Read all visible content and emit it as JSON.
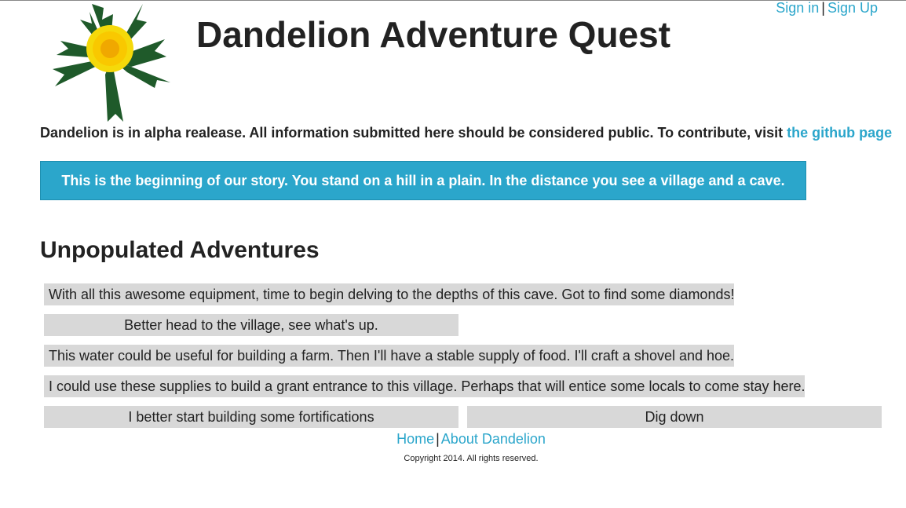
{
  "header": {
    "sign_in": "Sign in",
    "separator": "|",
    "sign_up": "Sign Up",
    "title": "Dandelion Adventure Quest"
  },
  "notice": {
    "text": "Dandelion is in alpha realease. All information submitted here should be considered public. To contribute, visit ",
    "link": "the github page"
  },
  "story": {
    "text": "This is the beginning of our story. You stand on a hill in a plain. In the distance you see a village and a cave."
  },
  "adventures": {
    "heading": "Unpopulated Adventures",
    "items": [
      "With all this awesome equipment, time to begin delving to the depths of this cave. Got to find some diamonds!",
      "Better head to the village, see what's up.",
      "This water could be useful for building a farm. Then I'll have a stable supply of food. I'll craft a shovel and hoe.",
      "I could use these supplies to build a grant entrance to this village. Perhaps that will entice some locals to come stay here.",
      "I better start building some fortifications",
      "Dig down"
    ]
  },
  "footer": {
    "home": "Home",
    "separator": "|",
    "about": "About Dandelion",
    "copyright": "Copyright 2014. All rights reserved."
  },
  "colors": {
    "link": "#2ba6cb",
    "story_bg": "#2ba6cb",
    "adventure_bg": "#d8d8d8",
    "logo_leaf": "#1f5a2a",
    "logo_flower": "#f5d90a"
  },
  "icons": {
    "logo": "dandelion-logo"
  }
}
